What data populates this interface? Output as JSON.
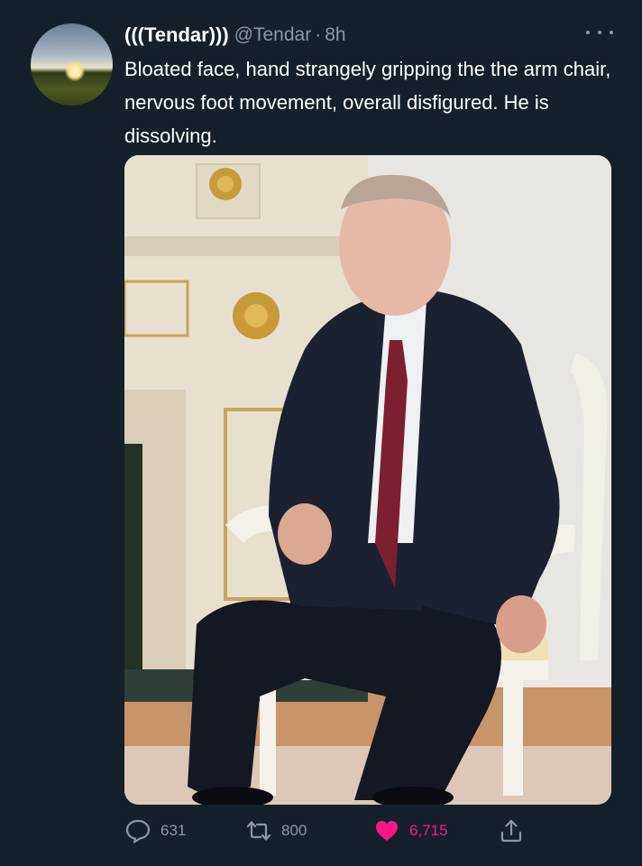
{
  "author": {
    "display_name": "(((Tendar)))",
    "handle": "@Tendar",
    "separator": "·",
    "time": "8h",
    "avatar": "sunset-field-avatar"
  },
  "tweet": {
    "text": "Bloated face, hand strangely gripping the the arm chair, nervous foot movement, overall disfigured. He is dissolving."
  },
  "media": {
    "type": "photo",
    "subject": "man-in-suit-seated-in-white-armchair"
  },
  "actions": {
    "replies": "631",
    "retweets": "800",
    "likes": "6,715",
    "liked": true
  },
  "icons": {
    "reply": "speech-bubble-icon",
    "retweet": "retweet-arrows-icon",
    "like": "heart-icon",
    "share": "share-upload-icon",
    "more": "more-dots-icon"
  },
  "colors": {
    "background": "#15202b",
    "secondary_text": "#8b98a5",
    "like_active": "#f91880",
    "primary_text": "#ffffff"
  }
}
